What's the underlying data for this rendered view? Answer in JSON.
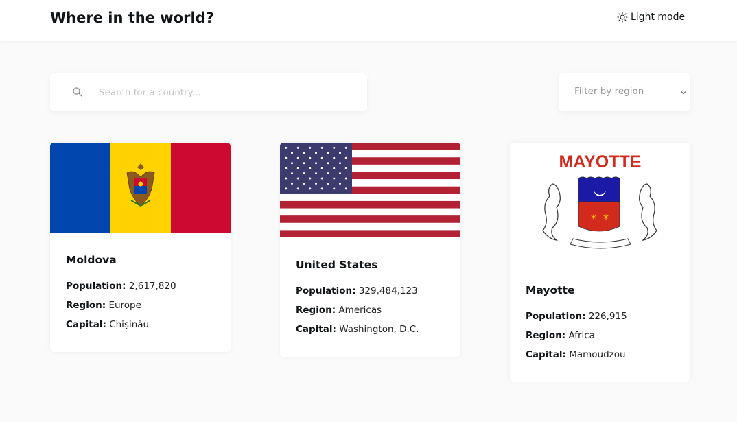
{
  "header": {
    "title": "Where in the world?",
    "mode_toggle_label": "Light mode",
    "mode_icon": "sun-icon"
  },
  "search": {
    "placeholder": "Search for a country...",
    "value": "",
    "icon": "search-icon"
  },
  "filter": {
    "label": "Filter by region",
    "icon": "chevron-down-icon"
  },
  "labels": {
    "population": "Population:",
    "region": "Region:",
    "capital": "Capital:"
  },
  "countries": [
    {
      "name": "Moldova",
      "population": "2,617,820",
      "region": "Europe",
      "capital": "Chișinău",
      "flag_colors": [
        "#0046ae",
        "#ffd200",
        "#cc092f"
      ]
    },
    {
      "name": "United States",
      "population": "329,484,123",
      "region": "Americas",
      "capital": "Washington, D.C.",
      "flag_colors": [
        "#b22234",
        "#ffffff",
        "#3c3b6e"
      ]
    },
    {
      "name": "Mayotte",
      "population": "226,915",
      "region": "Africa",
      "capital": "Mamoudzou",
      "flag_text": "MAYOTTE",
      "flag_colors": [
        "#d32a1e",
        "#1a1aa6",
        "#ffffff"
      ]
    }
  ]
}
